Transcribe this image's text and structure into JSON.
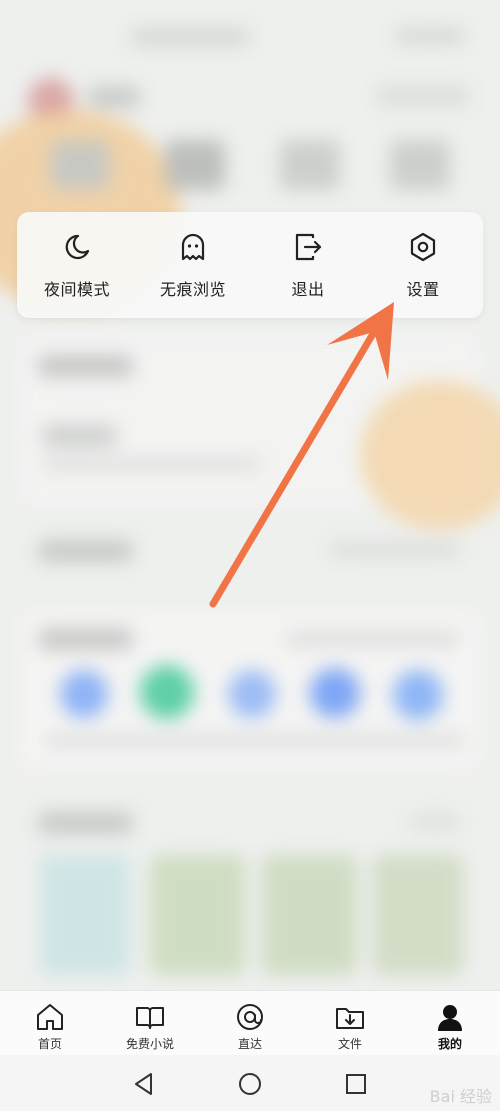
{
  "quick_actions": {
    "night_mode": "夜间模式",
    "incognito": "无痕浏览",
    "logout": "退出",
    "settings": "设置"
  },
  "tab_bar": {
    "home": "首页",
    "novels": "免费小说",
    "direct": "直达",
    "files": "文件",
    "mine": "我的"
  },
  "watermark": "Bai 经验",
  "colors": {
    "arrow": "#f07446",
    "accent_blue": "#7fa7f5",
    "accent_green": "#5fd0a8"
  },
  "icons": {
    "night_mode": "moon-icon",
    "incognito": "ghost-icon",
    "logout": "exit-icon",
    "settings": "hexagon-gear-icon",
    "home": "house-icon",
    "novels": "open-book-icon",
    "direct": "at-sign-icon",
    "files": "download-folder-icon",
    "mine": "user-icon"
  }
}
